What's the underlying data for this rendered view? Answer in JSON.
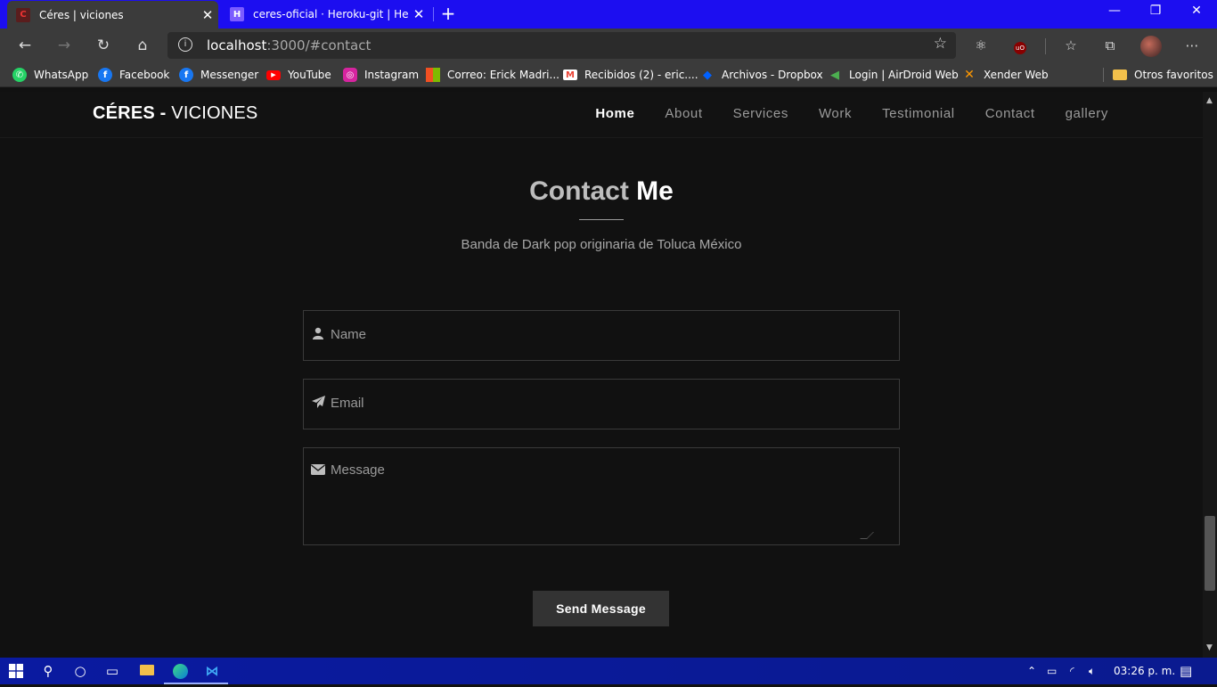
{
  "browser": {
    "tabs": [
      {
        "title": "Céres | viciones",
        "favicon": "ceres-favicon-icon",
        "active": true
      },
      {
        "title": "ceres-oficial · Heroku-git | Herok",
        "favicon": "heroku-icon",
        "active": false
      }
    ],
    "address": {
      "host": "localhost",
      "rest": ":3000/#contact"
    },
    "bookmarks": [
      {
        "label": "WhatsApp",
        "icon": "whatsapp-icon",
        "color": "#25d366"
      },
      {
        "label": "Facebook",
        "icon": "facebook-icon",
        "color": "#1877f2"
      },
      {
        "label": "Messenger",
        "icon": "messenger-icon",
        "color": "#1877f2"
      },
      {
        "label": "YouTube",
        "icon": "youtube-icon",
        "color": "#ff0000"
      },
      {
        "label": "Instagram",
        "icon": "instagram-icon",
        "color": "#d6249f"
      },
      {
        "label": "Correo: Erick Madri...",
        "icon": "microsoft-icon",
        "color": "#f25022"
      },
      {
        "label": "Recibidos (2) - eric....",
        "icon": "gmail-icon",
        "color": "#ea4335"
      },
      {
        "label": "Archivos - Dropbox",
        "icon": "dropbox-icon",
        "color": "#0061ff"
      },
      {
        "label": "Login | AirDroid Web",
        "icon": "airdroid-icon",
        "color": "#4caf50"
      },
      {
        "label": "Xender Web",
        "icon": "xender-icon",
        "color": "#ff9800"
      }
    ],
    "other_favorites": "Otros favoritos"
  },
  "page": {
    "brand": {
      "bold": "CÉRES -",
      "light": "VICIONES"
    },
    "nav": [
      "Home",
      "About",
      "Services",
      "Work",
      "Testimonial",
      "Contact",
      "gallery"
    ],
    "nav_active": "Home",
    "contact": {
      "title_light": "Contact",
      "title_bold": "Me",
      "subtitle": "Banda de Dark pop originaria de Toluca México",
      "name_placeholder": "Name",
      "email_placeholder": "Email",
      "message_placeholder": "Message",
      "send_label": "Send Message"
    }
  },
  "taskbar": {
    "clock": "03:26 p. m."
  }
}
